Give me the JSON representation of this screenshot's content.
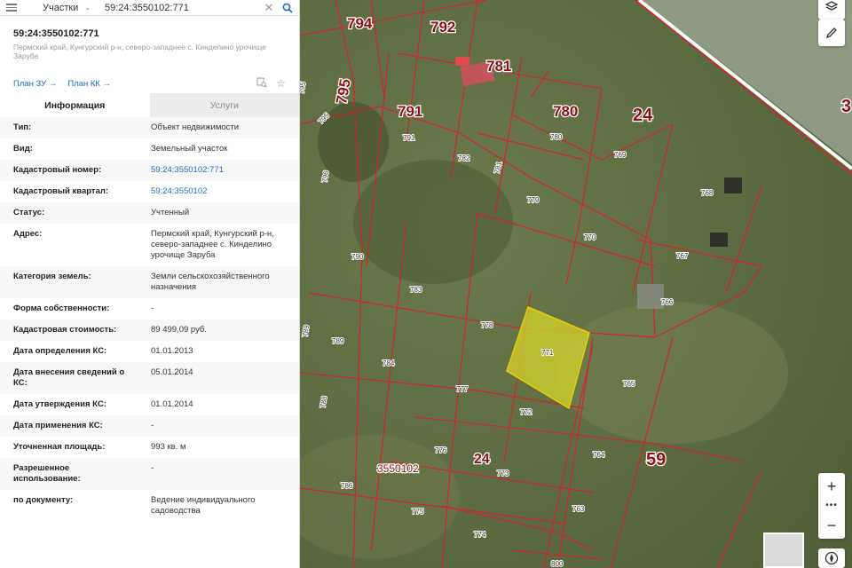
{
  "search": {
    "layer_label": "Участки",
    "value": "59:24:3550102:771",
    "placeholder": ""
  },
  "object": {
    "cad_number": "59:24:3550102:771",
    "address_short": "Пермский край, Кунгурский р-н, северо-западнее с. Кинделино урочище Заруба",
    "plan_zu": "План ЗУ →",
    "plan_kk": "План КК →"
  },
  "tabs": {
    "info": "Информация",
    "services": "Услуги"
  },
  "props": [
    {
      "k": "Тип:",
      "v": "Объект недвижимости"
    },
    {
      "k": "Вид:",
      "v": "Земельный участок"
    },
    {
      "k": "Кадастровый номер:",
      "v": "59:24:3550102:771"
    },
    {
      "k": "Кадастровый квартал:",
      "v": "59:24:3550102"
    },
    {
      "k": "Статус:",
      "v": "Учтенный"
    },
    {
      "k": "Адрес:",
      "v": "Пермский край, Кунгурский р-н, северо-западнее с. Кинделино урочище Заруба"
    },
    {
      "k": "Категория земель:",
      "v": "Земли сельскохозяйственного назначения"
    },
    {
      "k": "Форма собственности:",
      "v": "-"
    },
    {
      "k": "Кадастровая стоимость:",
      "v": "89 499,09 руб."
    },
    {
      "k": "Дата определения КС:",
      "v": "01.01.2013"
    },
    {
      "k": "Дата внесения сведений о КС:",
      "v": "05.01.2014"
    },
    {
      "k": "Дата утверждения КС:",
      "v": "01.01.2014"
    },
    {
      "k": "Дата применения КС:",
      "v": "-"
    },
    {
      "k": "Уточненная площадь:",
      "v": "993 кв. м"
    },
    {
      "k": "Разрешенное использование:",
      "v": "-"
    },
    {
      "k": "по документу:",
      "v": "Ведение индивидуального садоводства"
    }
  ],
  "map": {
    "labels_big": [
      "794",
      "792",
      "781",
      "795",
      "791",
      "780",
      "24",
      "3",
      "59",
      "24"
    ],
    "labels_small": [
      "795",
      "795",
      "791",
      "782",
      "781",
      "780",
      "769",
      "768",
      "779",
      "770",
      "767",
      "796",
      "790",
      "783",
      "766",
      "778",
      "771",
      "789",
      "784",
      "789",
      "765",
      "777",
      "772",
      "788",
      "776",
      "764",
      "773",
      "786",
      "775",
      "763",
      "774",
      "800"
    ],
    "quarter_label": "3550102",
    "colors": {
      "boundary": "#d2232a",
      "selected_fill": "#d6d62a",
      "selected_stroke": "#e6cf00"
    }
  },
  "controls": {
    "layers_icon": "layers-icon",
    "ruler_icon": "pencil-icon",
    "zoom_in": "+",
    "more": "•••",
    "zoom_out": "−",
    "locate_icon": "compass-icon",
    "collapse": "‹"
  }
}
